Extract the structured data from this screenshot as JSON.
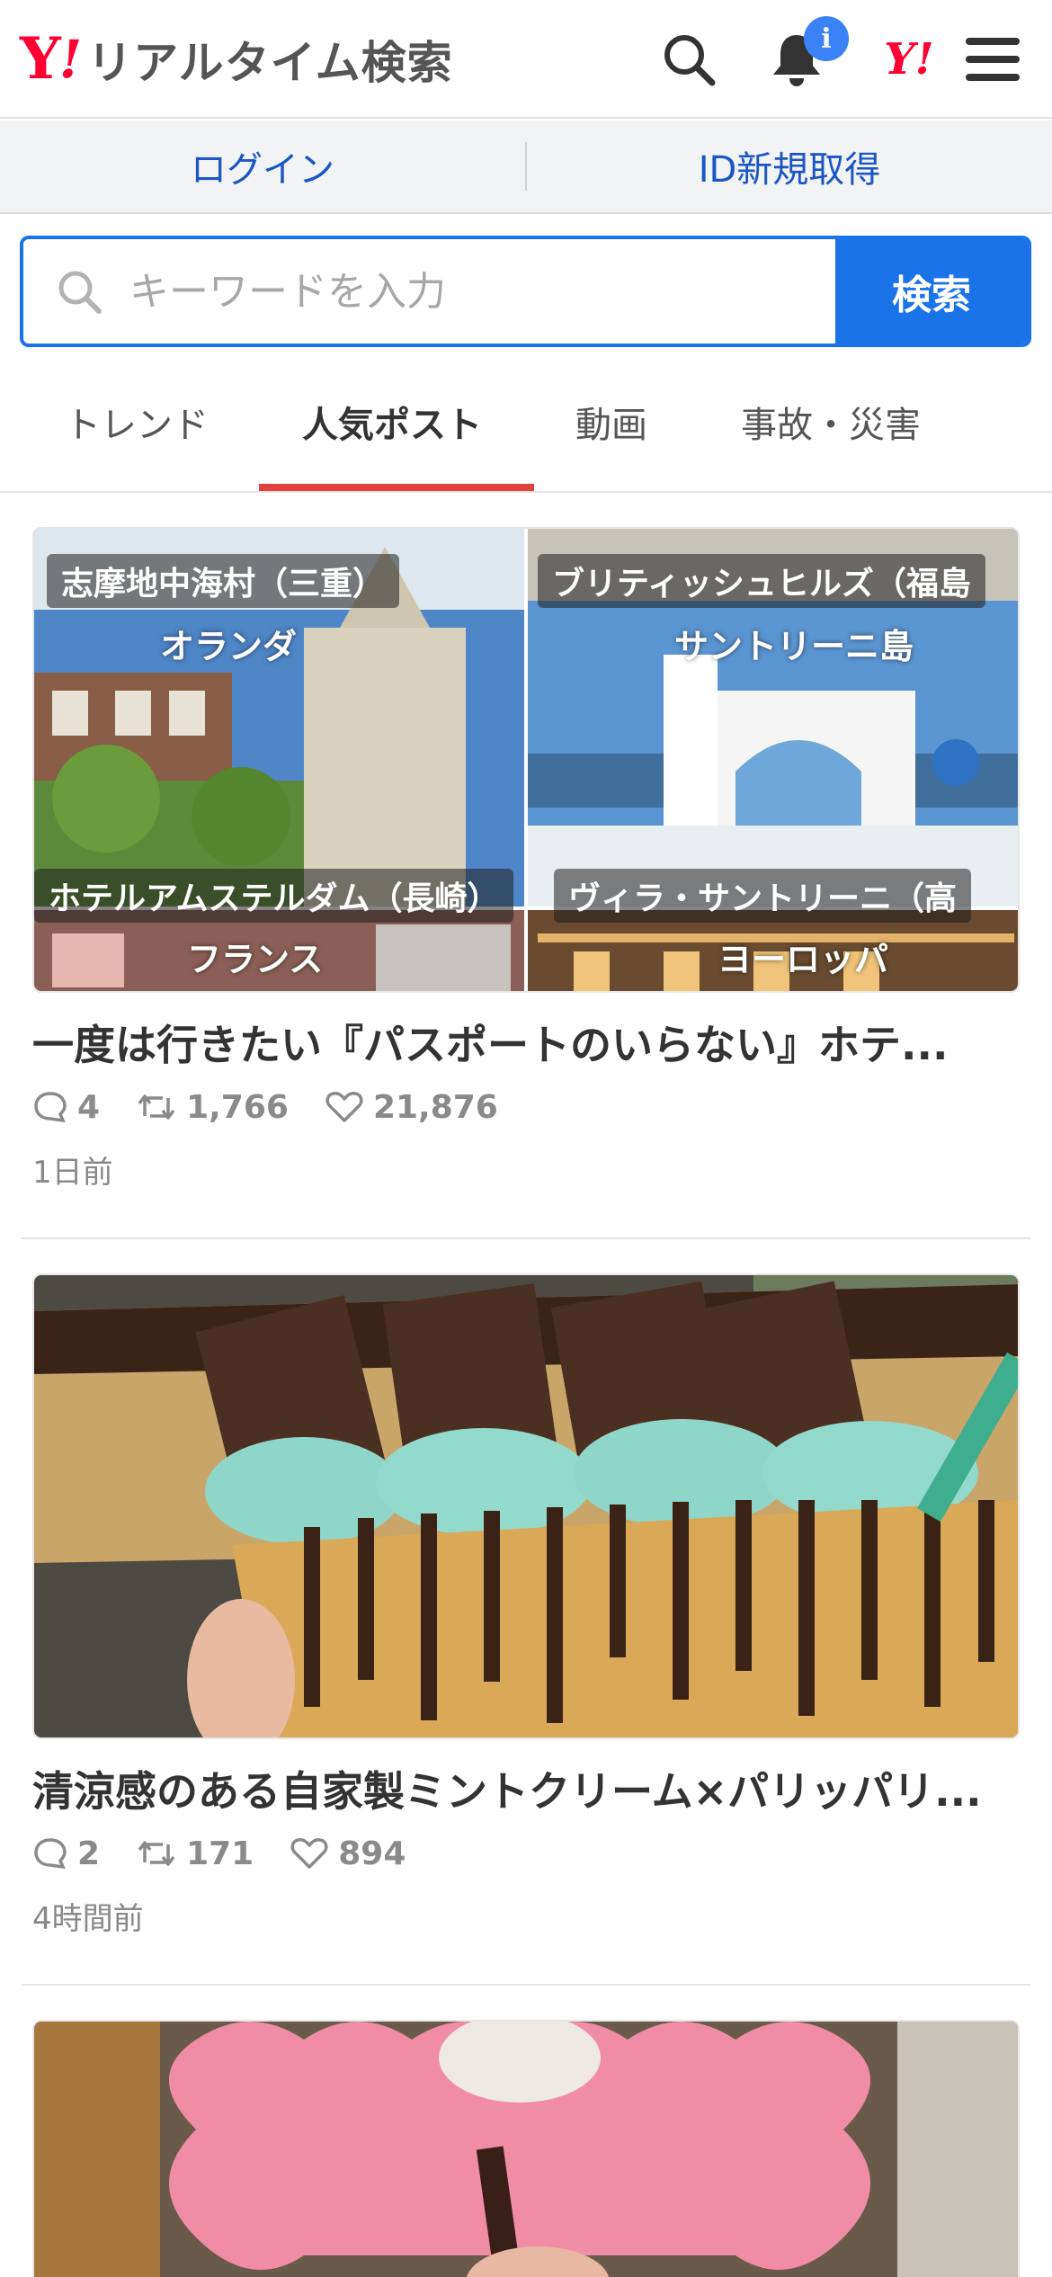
{
  "header": {
    "logo_y": "Y",
    "logo_ex": "!",
    "logo_text": "リアルタイム検索",
    "notification_badge": "i",
    "yahoo_icon_text": "Y!"
  },
  "auth": {
    "login_label": "ログイン",
    "signup_label": "ID新規取得"
  },
  "search": {
    "placeholder": "キーワードを入力",
    "button_label": "検索"
  },
  "tabs": [
    {
      "label": "トレンド",
      "active": false
    },
    {
      "label": "人気ポスト",
      "active": true
    },
    {
      "label": "動画",
      "active": false
    },
    {
      "label": "事故・災害",
      "active": false
    }
  ],
  "posts": [
    {
      "title": "一度は行きたい『パスポートのいらない』ホテ...",
      "replies": "4",
      "reposts": "1,766",
      "likes": "21,876",
      "time": "1日前",
      "overlay": {
        "tl_location": "志摩地中海村（三重）",
        "tl_country": "オランダ",
        "tr_location": "ブリティッシュヒルズ（福島",
        "tr_country": "サントリーニ島",
        "bl_location": "ホテルアムステルダム（長崎）",
        "bl_country": "フランス",
        "br_location": "ヴィラ・サントリーニ（高",
        "br_country": "ヨーロッパ"
      }
    },
    {
      "title": "清涼感のある自家製ミントクリーム×パリッパリ...",
      "replies": "2",
      "reposts": "171",
      "likes": "894",
      "time": "4時間前"
    },
    {
      "title": "",
      "replies": "",
      "reposts": "",
      "likes": "",
      "time": ""
    }
  ],
  "colors": {
    "brand_red": "#ff0033",
    "accent_blue": "#1a73e8",
    "link_blue": "#1a56c4",
    "tab_active": "#e0423d"
  }
}
